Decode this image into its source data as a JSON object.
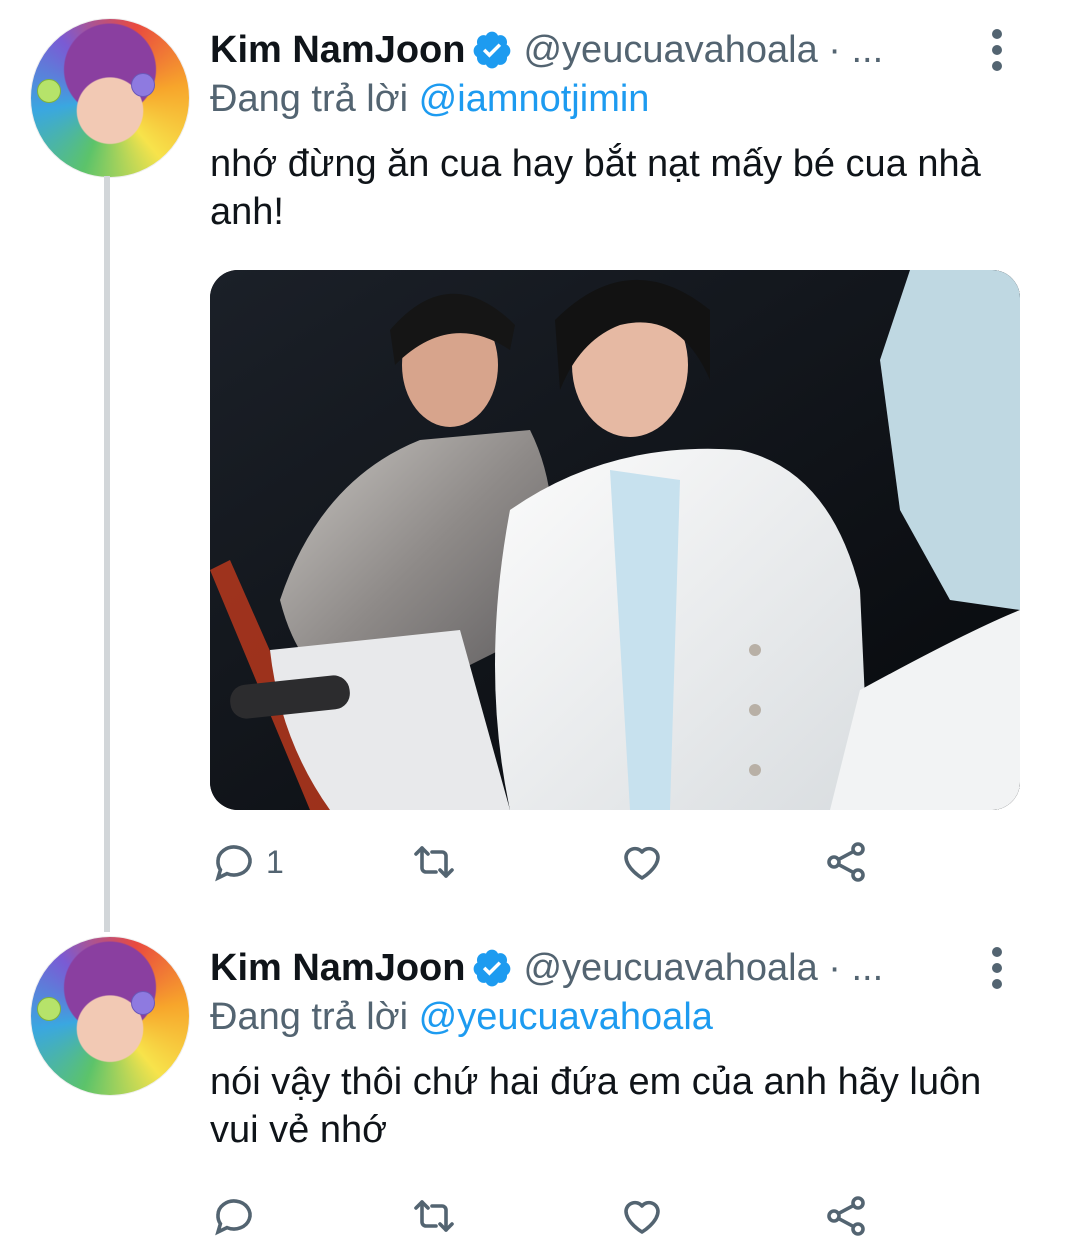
{
  "tweets": [
    {
      "author": "Kim NamJoon",
      "handle": "@yeucuavahoala · ...",
      "replying_prefix": "Đang trả lời",
      "replying_to": "@iamnotjimin",
      "text": "nhớ đừng ăn cua hay bắt nạt mấy bé cua nhà anh!",
      "has_media": true,
      "reply_count": "1"
    },
    {
      "author": "Kim NamJoon",
      "handle": "@yeucuavahoala · ...",
      "replying_prefix": "Đang trả lời",
      "replying_to": "@yeucuavahoala",
      "text": "nói vậy thôi chứ hai đứa em của anh hãy luôn vui vẻ nhớ",
      "has_media": false,
      "reply_count": ""
    }
  ],
  "icons": {
    "verified": "verified-badge-icon",
    "more": "more-vertical-icon",
    "reply": "reply-icon",
    "retweet": "retweet-icon",
    "like": "heart-icon",
    "share": "share-icon"
  },
  "colors": {
    "accent": "#1d9bf0",
    "secondary_text": "#536471",
    "thread_line": "#d2d6d9"
  }
}
